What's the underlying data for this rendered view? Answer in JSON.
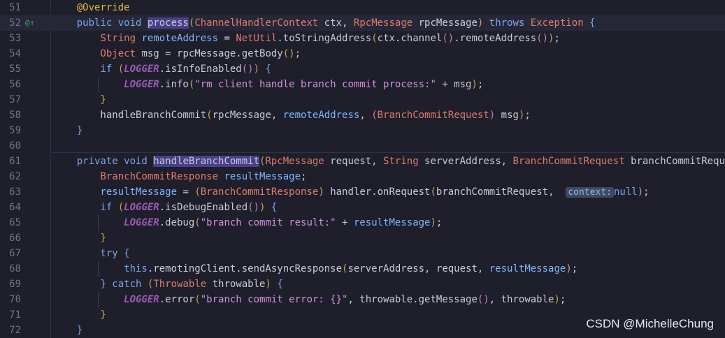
{
  "watermark": "CSDN @MichelleChung",
  "gutter_icon": "@↑",
  "lines": [
    {
      "n": "51",
      "tokens": [
        [
          "a",
          "    @Override"
        ]
      ]
    },
    {
      "n": "52",
      "current": true,
      "icon": true,
      "tokens": [
        [
          "k",
          "    public void "
        ],
        [
          "hl",
          "process"
        ],
        [
          "p",
          "("
        ],
        [
          "t",
          "ChannelHandlerContext"
        ],
        [
          "f",
          " ctx, "
        ],
        [
          "t",
          "RpcMessage"
        ],
        [
          "f",
          " rpcMessage"
        ],
        [
          "p",
          ")"
        ],
        [
          "k",
          " throws "
        ],
        [
          "t",
          "Exception"
        ],
        [
          "pb",
          " {"
        ]
      ]
    },
    {
      "n": "53",
      "tokens": [
        [
          "t",
          "        String"
        ],
        [
          "v",
          " remoteAddress"
        ],
        [
          "f",
          " = "
        ],
        [
          "t",
          "NetUtil"
        ],
        [
          "f",
          ".toStringAddress"
        ],
        [
          "p",
          "("
        ],
        [
          "f",
          "ctx.channel"
        ],
        [
          "pl",
          "()"
        ],
        [
          "f",
          ".remoteAddress"
        ],
        [
          "pl",
          "()"
        ],
        [
          "p",
          ")"
        ],
        [
          "f",
          ";"
        ]
      ]
    },
    {
      "n": "54",
      "tokens": [
        [
          "t",
          "        Object"
        ],
        [
          "f",
          " msg = rpcMessage.getBody"
        ],
        [
          "p",
          "()"
        ],
        [
          "f",
          ";"
        ]
      ]
    },
    {
      "n": "55",
      "tokens": [
        [
          "k",
          "        if "
        ],
        [
          "p",
          "("
        ],
        [
          "lg",
          "LOGGER"
        ],
        [
          "f",
          ".isInfoEnabled"
        ],
        [
          "pl",
          "()"
        ],
        [
          "p",
          ")"
        ],
        [
          "pb",
          " {"
        ]
      ]
    },
    {
      "n": "56",
      "tokens": [
        [
          "lg",
          "            LOGGER"
        ],
        [
          "f",
          ".info"
        ],
        [
          "p",
          "("
        ],
        [
          "s",
          "\"rm client handle branch commit process:\""
        ],
        [
          "f",
          " + msg"
        ],
        [
          "p",
          ")"
        ],
        [
          "f",
          ";"
        ]
      ]
    },
    {
      "n": "57",
      "tokens": [
        [
          "p",
          "        }"
        ]
      ]
    },
    {
      "n": "58",
      "tokens": [
        [
          "f",
          "        handleBranchCommit"
        ],
        [
          "p",
          "("
        ],
        [
          "f",
          "rpcMessage, "
        ],
        [
          "v",
          "remoteAddress"
        ],
        [
          "f",
          ", "
        ],
        [
          "pl",
          "("
        ],
        [
          "t",
          "BranchCommitRequest"
        ],
        [
          "pl",
          ")"
        ],
        [
          "f",
          " msg"
        ],
        [
          "p",
          ")"
        ],
        [
          "f",
          ";"
        ]
      ]
    },
    {
      "n": "59",
      "tokens": [
        [
          "pb",
          "    }"
        ]
      ]
    },
    {
      "n": "60",
      "tokens": []
    },
    {
      "n": "61",
      "tokens": [
        [
          "k",
          "    private void "
        ],
        [
          "hl",
          "handleBranchCommit"
        ],
        [
          "p",
          "("
        ],
        [
          "t",
          "RpcMessage"
        ],
        [
          "f",
          " request, "
        ],
        [
          "t",
          "String"
        ],
        [
          "f",
          " serverAddress, "
        ],
        [
          "t",
          "BranchCommitRequest"
        ],
        [
          "f",
          " branchCommitRequest"
        ],
        [
          "p",
          ")"
        ],
        [
          "pb",
          " {"
        ]
      ]
    },
    {
      "n": "62",
      "tokens": [
        [
          "t",
          "        BranchCommitResponse"
        ],
        [
          "v",
          " resultMessage"
        ],
        [
          "f",
          ";"
        ]
      ]
    },
    {
      "n": "63",
      "tokens": [
        [
          "v",
          "        resultMessage"
        ],
        [
          "f",
          " = "
        ],
        [
          "p",
          "("
        ],
        [
          "t",
          "BranchCommitResponse"
        ],
        [
          "p",
          ")"
        ],
        [
          "f",
          " handler.onRequest"
        ],
        [
          "p",
          "("
        ],
        [
          "f",
          "branchCommitRequest,  "
        ],
        [
          "hint",
          "context:"
        ],
        [
          "k",
          "null"
        ],
        [
          "p",
          ")"
        ],
        [
          "f",
          ";"
        ]
      ]
    },
    {
      "n": "64",
      "tokens": [
        [
          "k",
          "        if "
        ],
        [
          "p",
          "("
        ],
        [
          "lg",
          "LOGGER"
        ],
        [
          "f",
          ".isDebugEnabled"
        ],
        [
          "pl",
          "()"
        ],
        [
          "p",
          ")"
        ],
        [
          "pb",
          " {"
        ]
      ]
    },
    {
      "n": "65",
      "tokens": [
        [
          "lg",
          "            LOGGER"
        ],
        [
          "f",
          ".debug"
        ],
        [
          "p",
          "("
        ],
        [
          "s",
          "\"branch commit result:\""
        ],
        [
          "f",
          " + "
        ],
        [
          "v",
          "resultMessage"
        ],
        [
          "p",
          ")"
        ],
        [
          "f",
          ";"
        ]
      ]
    },
    {
      "n": "66",
      "tokens": [
        [
          "p",
          "        }"
        ]
      ]
    },
    {
      "n": "67",
      "tokens": [
        [
          "k",
          "        try"
        ],
        [
          "pb",
          " {"
        ]
      ]
    },
    {
      "n": "68",
      "tokens": [
        [
          "k",
          "            this"
        ],
        [
          "f",
          ".remotingClient.sendAsyncResponse"
        ],
        [
          "p",
          "("
        ],
        [
          "f",
          "serverAddress, request, "
        ],
        [
          "v",
          "resultMessage"
        ],
        [
          "p",
          ")"
        ],
        [
          "f",
          ";"
        ]
      ]
    },
    {
      "n": "69",
      "tokens": [
        [
          "pb",
          "        }"
        ],
        [
          "k",
          " catch "
        ],
        [
          "p",
          "("
        ],
        [
          "t",
          "Throwable"
        ],
        [
          "f",
          " throwable"
        ],
        [
          "p",
          ")"
        ],
        [
          "pb",
          " {"
        ]
      ]
    },
    {
      "n": "70",
      "tokens": [
        [
          "lg",
          "            LOGGER"
        ],
        [
          "f",
          ".error"
        ],
        [
          "p",
          "("
        ],
        [
          "s",
          "\"branch commit error: {}\""
        ],
        [
          "f",
          ", throwable.getMessage"
        ],
        [
          "pl",
          "()"
        ],
        [
          "f",
          ", throwable"
        ],
        [
          "p",
          ")"
        ],
        [
          "f",
          ";"
        ]
      ]
    },
    {
      "n": "71",
      "tokens": [
        [
          "p",
          "        }"
        ]
      ]
    },
    {
      "n": "72",
      "tokens": [
        [
          "pb",
          "    }"
        ]
      ]
    }
  ]
}
